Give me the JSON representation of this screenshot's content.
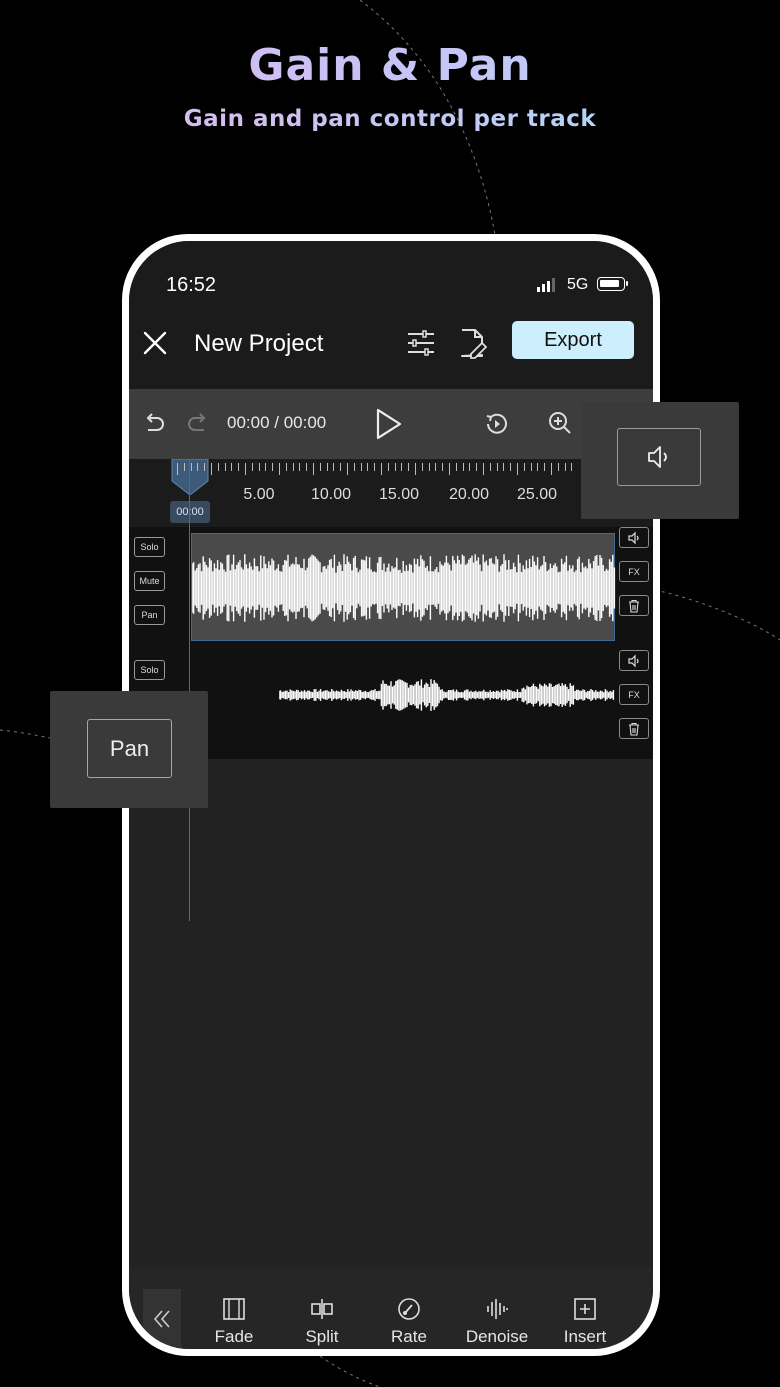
{
  "promo": {
    "headline": "Gain & Pan",
    "subheadline": "Gain and pan control per track"
  },
  "status_bar": {
    "time": "16:52",
    "network": "5G",
    "icons": [
      "signal-icon",
      "battery-icon"
    ]
  },
  "header": {
    "close_icon": "close-icon",
    "title": "New Project",
    "tools": [
      "mixer-sliders-icon",
      "edit-file-icon"
    ],
    "export_label": "Export",
    "accent_color": "#cdeefd"
  },
  "transport": {
    "current_time": "00:00",
    "separator": " / ",
    "total_time": "00:00",
    "icons": [
      "undo-icon",
      "redo-icon",
      "play-icon",
      "loop-icon",
      "zoom-in-icon"
    ]
  },
  "ruler": {
    "labels": [
      "5.00",
      "10.00",
      "15.00",
      "20.00",
      "25.00"
    ],
    "playhead_time": "00:00"
  },
  "tracks": [
    {
      "controls": [
        "Solo",
        "Mute",
        "Pan"
      ],
      "right_controls": [
        "volume-icon",
        "FX",
        "trash-icon"
      ]
    },
    {
      "controls": [
        "Solo"
      ],
      "right_controls": [
        "volume-icon",
        "FX",
        "trash-icon"
      ]
    }
  ],
  "popups": {
    "pan_label": "Pan",
    "volume_icon": "volume-icon"
  },
  "bottom_toolbar": {
    "collapse_icon": "double-chevron-left-icon",
    "items": [
      {
        "label": "Fade",
        "icon": "fade-icon"
      },
      {
        "label": "Split",
        "icon": "split-icon"
      },
      {
        "label": "Rate",
        "icon": "rate-icon"
      },
      {
        "label": "Denoise",
        "icon": "denoise-icon"
      },
      {
        "label": "Insert",
        "icon": "insert-icon"
      }
    ]
  }
}
